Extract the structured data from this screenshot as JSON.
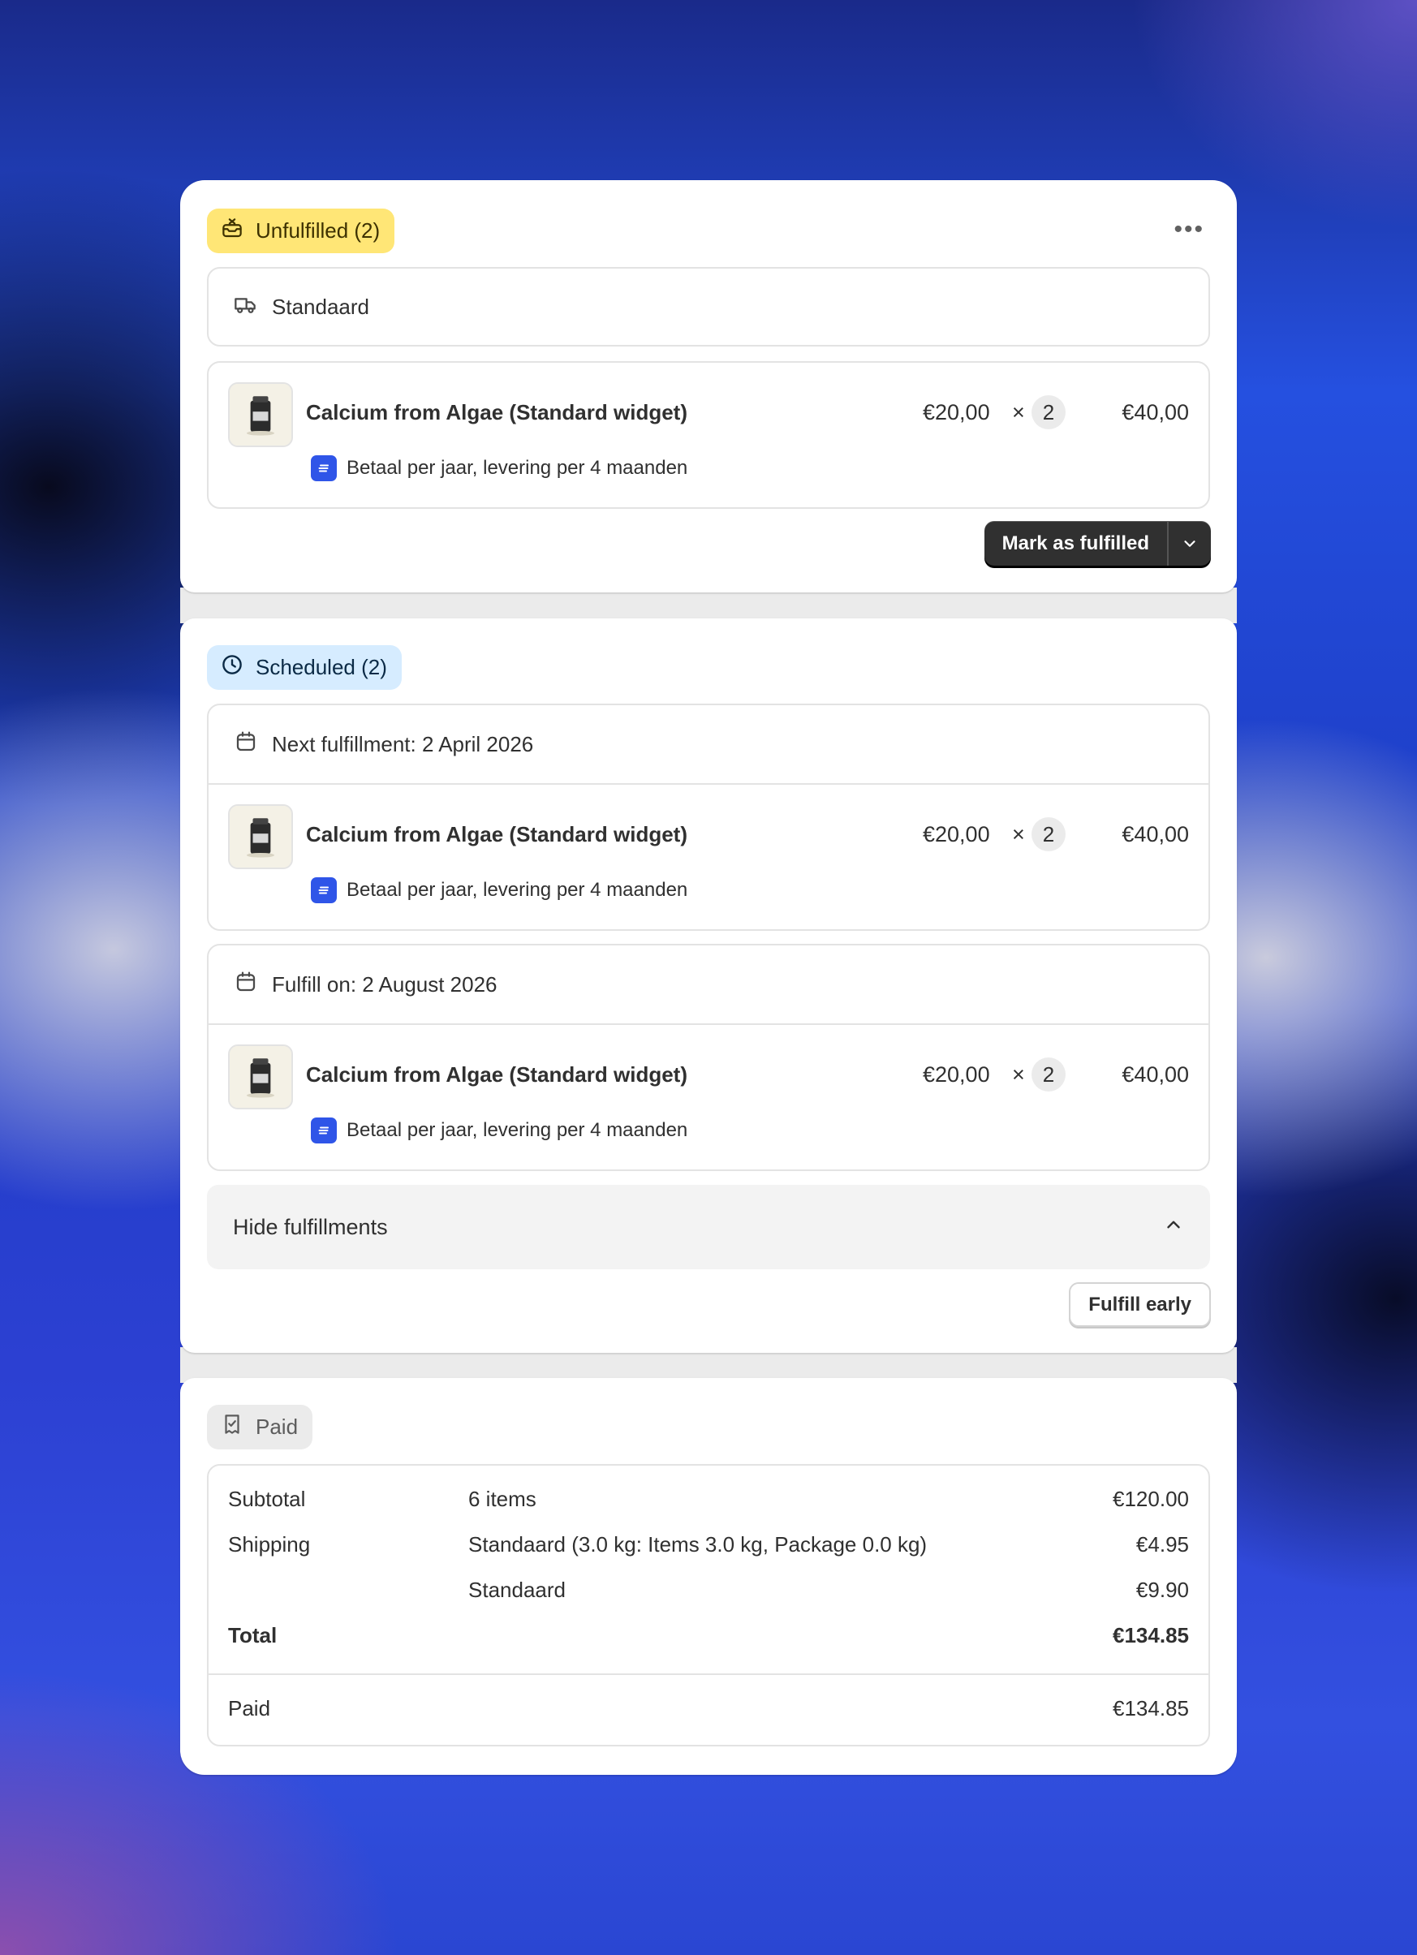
{
  "unfulfilled": {
    "badge": "Unfulfilled (2)",
    "more_label": "•••",
    "shipping_method": "Standaard",
    "item": {
      "title": "Calcium from Algae (Standard widget)",
      "price": "€20,00",
      "times": "×",
      "qty": "2",
      "total": "€40,00",
      "plan": "Betaal per jaar, levering per 4 maanden"
    },
    "primary_button": "Mark as fulfilled"
  },
  "scheduled": {
    "badge": "Scheduled (2)",
    "groups": [
      {
        "heading": "Next fulfillment: 2 April 2026",
        "item": {
          "title": "Calcium from Algae (Standard widget)",
          "price": "€20,00",
          "times": "×",
          "qty": "2",
          "total": "€40,00",
          "plan": "Betaal per jaar, levering per 4 maanden"
        }
      },
      {
        "heading": "Fulfill on: 2 August 2026",
        "item": {
          "title": "Calcium from Algae (Standard widget)",
          "price": "€20,00",
          "times": "×",
          "qty": "2",
          "total": "€40,00",
          "plan": "Betaal per jaar, levering per 4 maanden"
        }
      }
    ],
    "hide_label": "Hide fulfillments",
    "fulfill_early": "Fulfill early"
  },
  "payment": {
    "badge": "Paid",
    "rows": [
      {
        "label": "Subtotal",
        "detail": "6 items",
        "amount": "€120.00"
      },
      {
        "label": "Shipping",
        "detail": "Standaard (3.0 kg: Items 3.0 kg, Package 0.0 kg)",
        "amount": "€4.95"
      },
      {
        "label": "",
        "detail": "Standaard",
        "amount": "€9.90"
      },
      {
        "label": "Total",
        "detail": "",
        "amount": "€134.85"
      }
    ],
    "paid_label": "Paid",
    "paid_amount": "€134.85"
  },
  "colors": {
    "unfulfilled_badge": "#ffe676",
    "scheduled_badge": "#d6ecff",
    "paid_badge": "#ebebeb",
    "plan_icon": "#2f55e8",
    "primary_button": "#303030"
  },
  "icons": {
    "unfulfilled": "package-x-icon",
    "shipping": "truck-icon",
    "scheduled": "clock-icon",
    "date": "calendar-icon",
    "paid": "receipt-check-icon",
    "plan": "subscription-app-icon",
    "dropdown": "chevron-down-icon",
    "collapse": "chevron-up-icon",
    "more": "more-horizontal-icon"
  }
}
